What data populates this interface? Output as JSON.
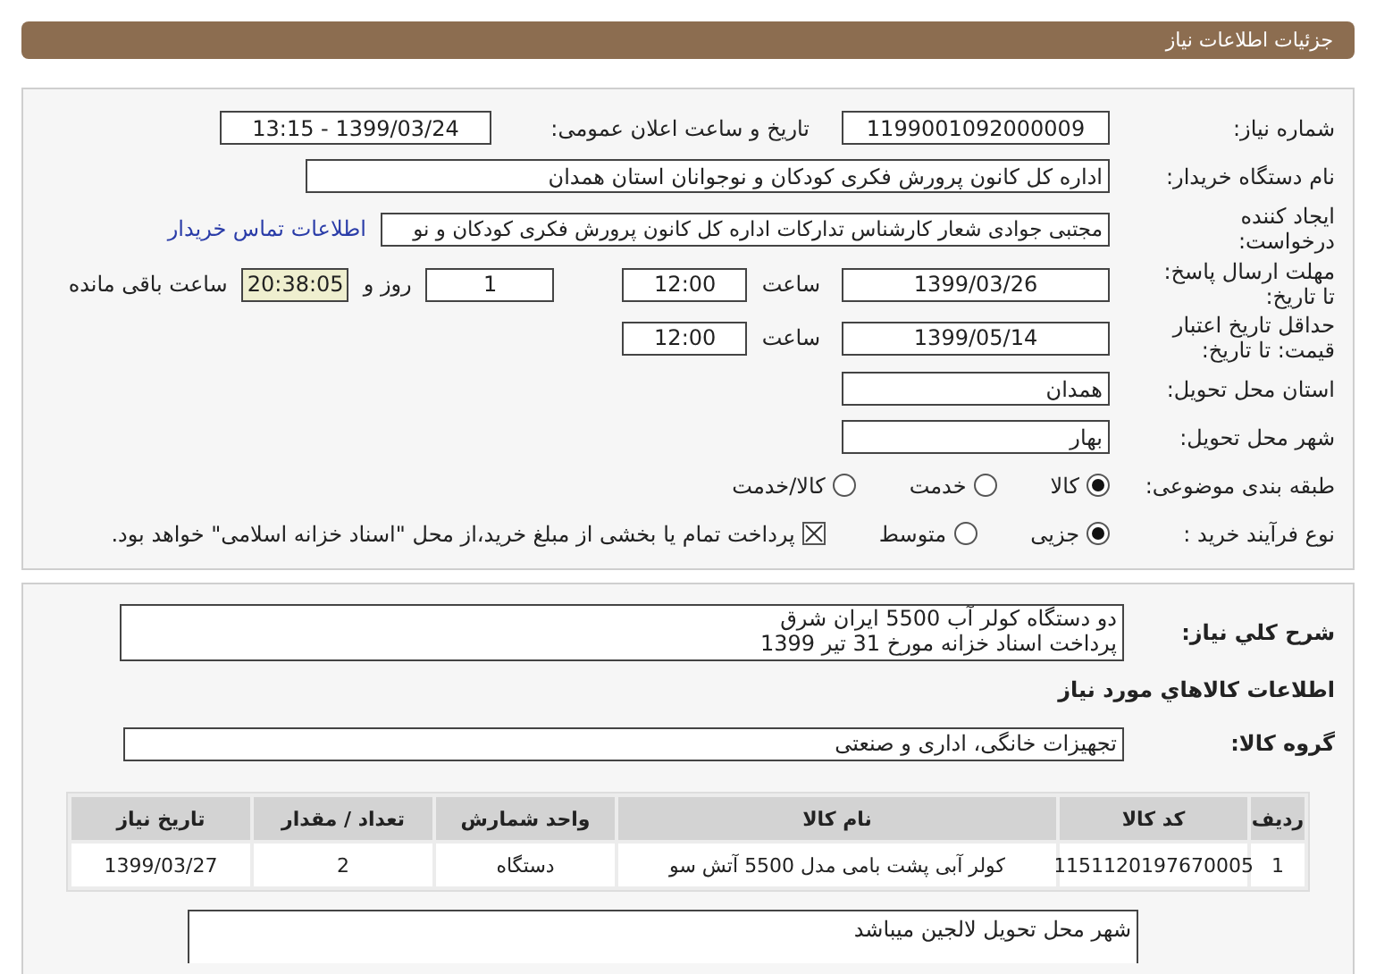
{
  "header": {
    "title": "جزئیات اطلاعات نیاز"
  },
  "need_number": {
    "label": "شماره نیاز:",
    "value": "1199001092000009"
  },
  "announce": {
    "label": "تاریخ و ساعت اعلان عمومی:",
    "value": "1399/03/24 - 13:15"
  },
  "buyer": {
    "label": "نام دستگاه خریدار:",
    "value": "اداره کل کانون پرورش فکری کودکان و نوجوانان استان همدان"
  },
  "requester": {
    "label_lines": [
      "ایجاد کننده",
      "درخواست:"
    ],
    "value": "مجتبی جوادی شعار کارشناس تدارکات اداره کل کانون پرورش فکری کودکان و نو",
    "link": "اطلاعات تماس خریدار"
  },
  "deadline": {
    "label_lines": [
      "مهلت ارسال پاسخ:",
      "تا تاریخ:"
    ],
    "date": "1399/03/26",
    "time_label": "ساعت",
    "time": "12:00",
    "days": "1",
    "days_label": "روز و",
    "remaining": "20:38:05",
    "remaining_label": "ساعت باقی مانده"
  },
  "validity": {
    "label_lines": [
      "حداقل تاریخ اعتبار",
      "قیمت: تا تاریخ:"
    ],
    "date": "1399/05/14",
    "time_label": "ساعت",
    "time": "12:00"
  },
  "province": {
    "label": "استان محل تحویل:",
    "value": "همدان"
  },
  "city": {
    "label": "شهر محل تحویل:",
    "value": "بهار"
  },
  "category": {
    "label": "طبقه بندی موضوعی:",
    "options": [
      {
        "label": "کالا",
        "selected": true
      },
      {
        "label": "خدمت",
        "selected": false
      },
      {
        "label": "کالا/خدمت",
        "selected": false
      }
    ]
  },
  "process": {
    "label": "نوع فرآیند خرید :",
    "options": [
      {
        "label": "جزیی",
        "selected": true
      },
      {
        "label": "متوسط",
        "selected": false
      }
    ],
    "payment": {
      "checked": true,
      "text": "پرداخت تمام یا بخشی از مبلغ خرید،از محل \"اسناد خزانه اسلامی\" خواهد بود."
    }
  },
  "description": {
    "label": "شرح کلي نياز:",
    "lines": [
      "دو دستگاه کولر آب 5500 ایران شرق",
      "پرداخت اسناد خزانه مورخ 31 تیر 1399"
    ]
  },
  "goods_title": "اطلاعات کالاهاي مورد نياز",
  "goods_group": {
    "label": "گروه کالا:",
    "value": "تجهیزات خانگی، اداری و صنعتی"
  },
  "table": {
    "columns": [
      "ردیف",
      "کد کالا",
      "نام کالا",
      "واحد شمارش",
      "تعداد / مقدار",
      "تاریخ نیاز"
    ],
    "rows": [
      [
        "1",
        "1151120197670005",
        "کولر آبی پشت بامی مدل 5500 آتش سو",
        "دستگاه",
        "2",
        "1399/03/27"
      ]
    ]
  },
  "note": "شهر محل تحویل لالجین میباشد"
}
